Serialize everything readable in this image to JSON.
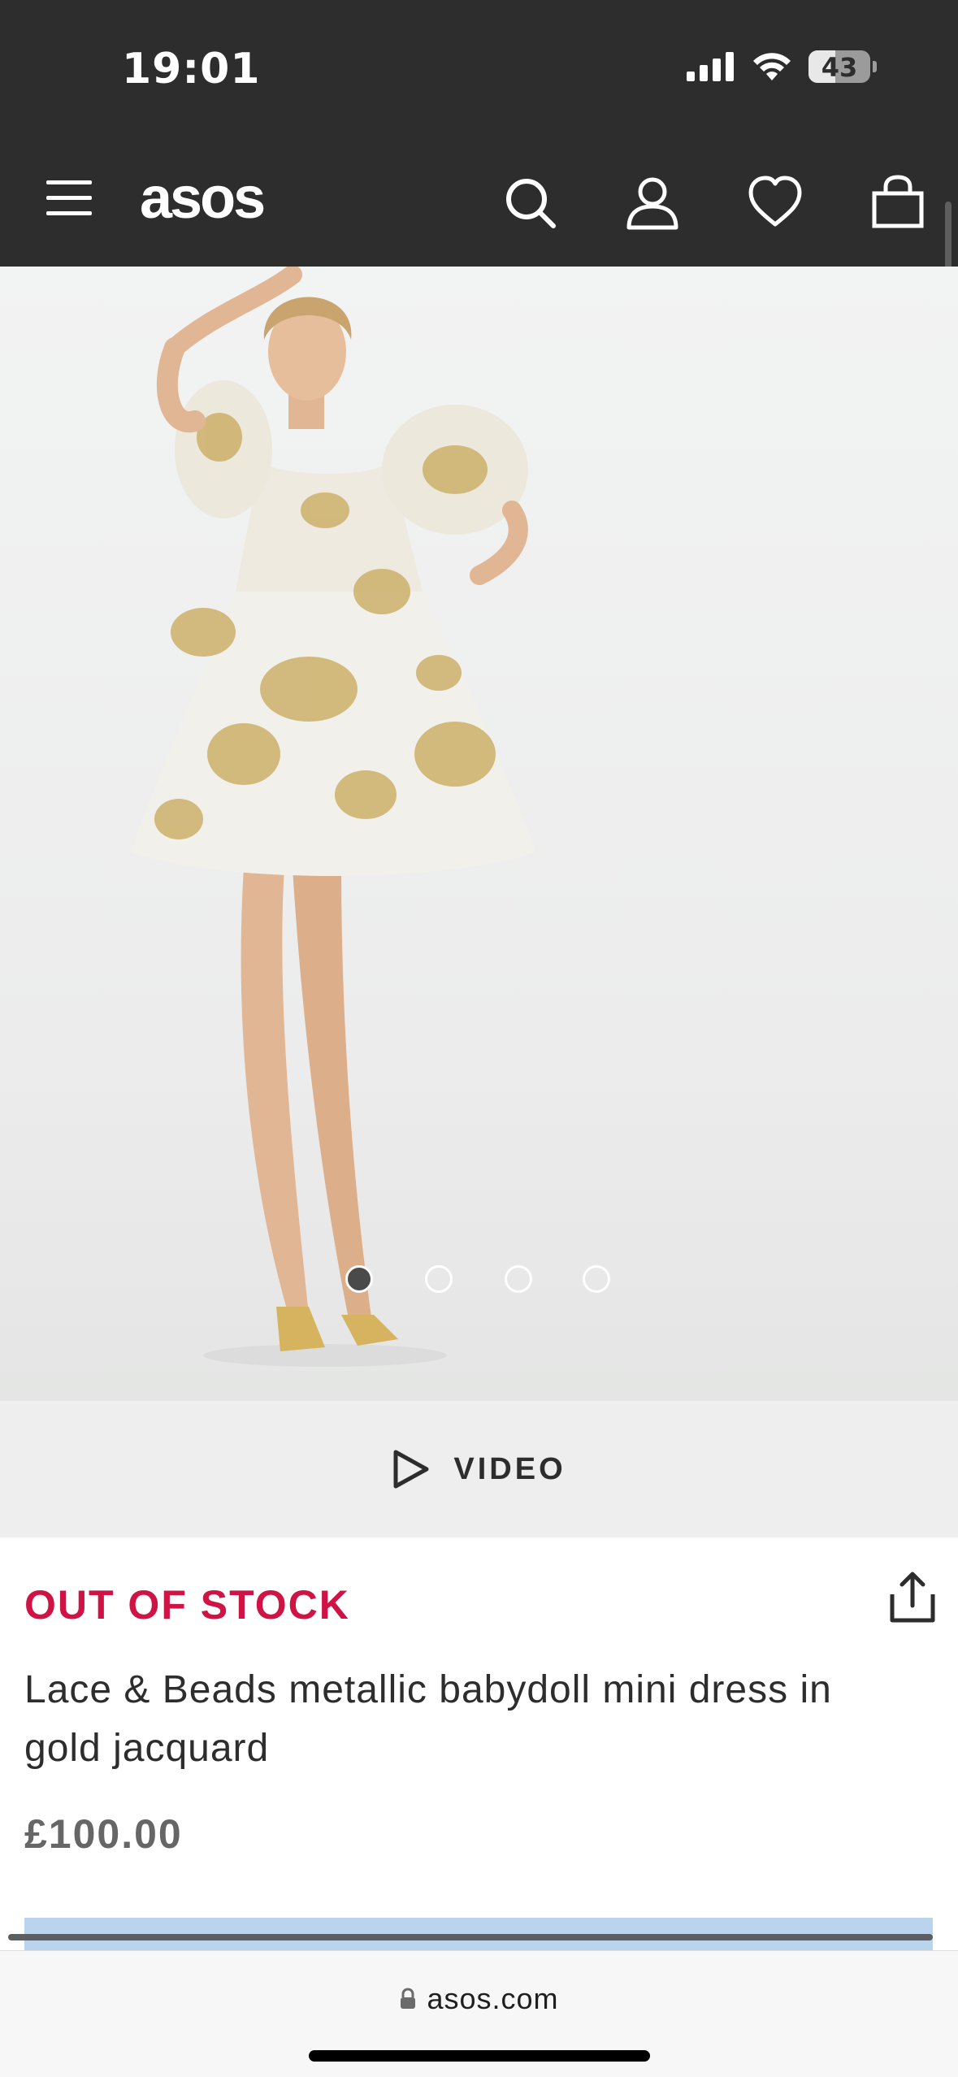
{
  "status_bar": {
    "time": "19:01",
    "battery_level": "43",
    "battery_fraction": 0.43,
    "icons": [
      "cellular-signal-icon",
      "wifi-icon",
      "battery-icon"
    ]
  },
  "header": {
    "logo": "asos",
    "icons": [
      "hamburger-menu-icon",
      "search-icon",
      "account-icon",
      "heart-icon",
      "bag-icon"
    ]
  },
  "gallery": {
    "image_alt": "Lace & Beads metallic babydoll mini dress in gold jacquard",
    "slide_count": 4,
    "active_slide": 1
  },
  "video_button": {
    "label": "VIDEO",
    "icon": "play-icon"
  },
  "product": {
    "stock_status": "OUT OF STOCK",
    "title": "Lace & Beads metallic babydoll mini dress in gold jacquard",
    "price": "£100.00",
    "share_icon": "share-icon"
  },
  "browser": {
    "url": "asos.com",
    "lock_icon": "lock-icon"
  },
  "colors": {
    "header_bg": "#2d2d2d",
    "stock_red": "#d01345",
    "price_gray": "#666666",
    "video_bar_bg": "#eeeeee"
  }
}
